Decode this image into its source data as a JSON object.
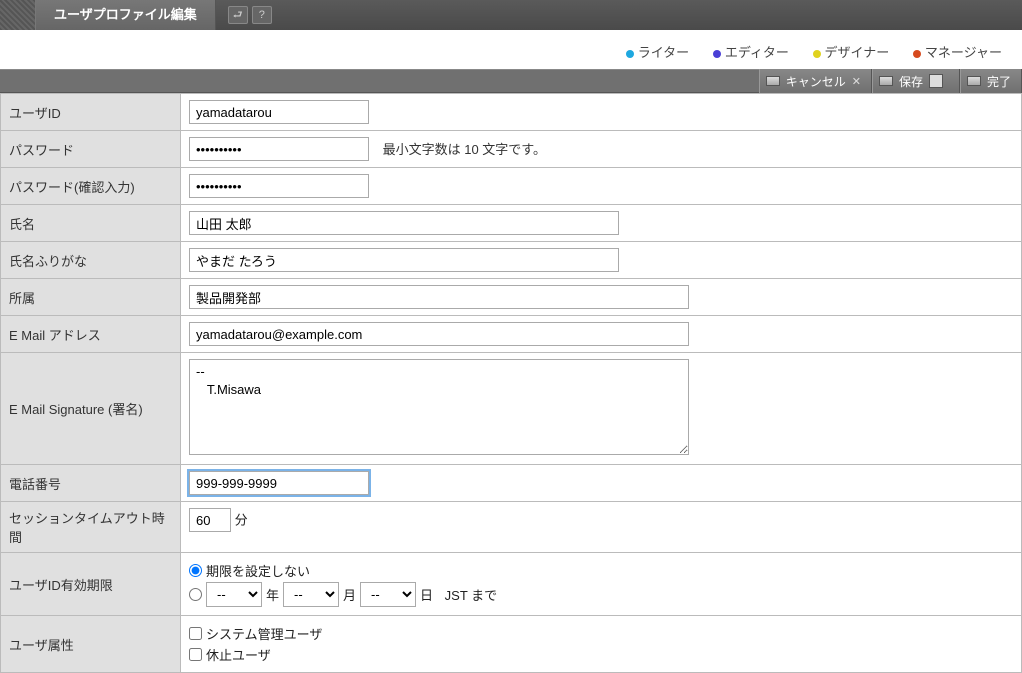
{
  "header": {
    "title": "ユーザプロファイル編集"
  },
  "roles": [
    {
      "label": "ライター",
      "color": "#1ea8e0"
    },
    {
      "label": "エディター",
      "color": "#4a3fd6"
    },
    {
      "label": "デザイナー",
      "color": "#e0d21e"
    },
    {
      "label": "マネージャー",
      "color": "#d64a1e"
    }
  ],
  "toolbar": {
    "cancel": "キャンセル",
    "save": "保存",
    "done": "完了"
  },
  "form": {
    "user_id": {
      "label": "ユーザID",
      "value": "yamadatarou"
    },
    "password": {
      "label": "パスワード",
      "value": "••••••••••",
      "hint": "最小文字数は 10 文字です。"
    },
    "password_confirm": {
      "label": "パスワード(確認入力)",
      "value": "••••••••••"
    },
    "name": {
      "label": "氏名",
      "value": "山田 太郎"
    },
    "name_kana": {
      "label": "氏名ふりがな",
      "value": "やまだ たろう"
    },
    "department": {
      "label": "所属",
      "value": "製品開発部"
    },
    "email": {
      "label": "E Mail アドレス",
      "value": "yamadatarou@example.com"
    },
    "signature": {
      "label": "E Mail Signature (署名)",
      "value": "--\n   T.Misawa"
    },
    "phone": {
      "label": "電話番号",
      "value": "999-999-9999"
    },
    "timeout": {
      "label": "セッションタイムアウト時間",
      "value": "60",
      "unit": "分"
    },
    "expiry": {
      "label": "ユーザID有効期限",
      "opt_none": "期限を設定しない",
      "year_suffix": "年",
      "month_suffix": "月",
      "day_suffix": "日",
      "tz_suffix": "JST  まで",
      "dash": "--"
    },
    "attributes": {
      "label": "ユーザ属性",
      "admin": "システム管理ユーザ",
      "suspended": "休止ユーザ"
    }
  }
}
